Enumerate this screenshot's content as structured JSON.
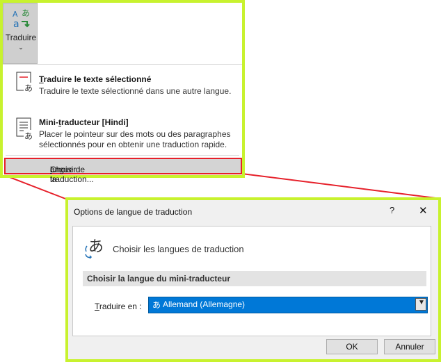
{
  "ribbon": {
    "translate_label": "Traduire",
    "chevron": "⌄",
    "icon": "translate-icon"
  },
  "menu": {
    "items": [
      {
        "title_first": "T",
        "title_rest": "raduire le texte sélectionné",
        "description": "Traduire le texte sélectionné dans une autre langue.",
        "icon": "translate-document-icon"
      },
      {
        "title_pre": "Mini-",
        "title_u": "t",
        "title_rest": "raducteur [Hindi]",
        "description_line1": "Placer le pointeur sur des mots ou des paragraphes",
        "description_line2": "sélectionnés pour en obtenir une traduction rapide.",
        "icon": "mini-translator-icon"
      }
    ],
    "choose_language_pre": "Choisir la ",
    "choose_language_u": "l",
    "choose_language_rest": "angue de traduction..."
  },
  "dialog": {
    "title": "Options de langue de traduction",
    "help": "?",
    "close": "✕",
    "heading": "Choisir les langues de traduction",
    "section": "Choisir la langue du mini-traducteur",
    "translate_to_u": "T",
    "translate_to_rest": "raduire en :",
    "selected_language": "Allemand (Allemagne)",
    "selected_glyph": "あ",
    "ok_label": "OK",
    "cancel_label": "Annuler"
  },
  "colors": {
    "highlight_border": "#c8f22e",
    "callout_red": "#e6202a",
    "select_blue": "#0078d7"
  }
}
